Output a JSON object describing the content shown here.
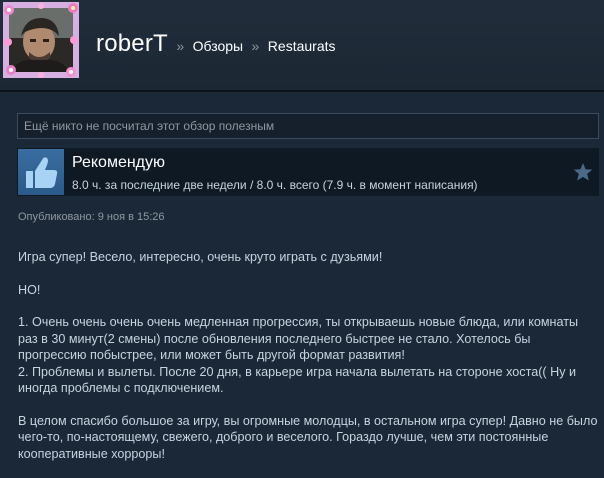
{
  "header": {
    "username": "roberT",
    "separator": "»",
    "breadcrumb_reviews": "Обзоры",
    "breadcrumb_game": "Restaurats"
  },
  "helpful_box": {
    "text": "Ещё никто не посчитал этот обзор полезным"
  },
  "recommendation": {
    "title": "Рекомендую",
    "hours": "8.0 ч. за последние две недели / 8.0 ч. всего (7.9 ч. в момент написания)",
    "icon": "thumbs-up-icon",
    "award_icon": "star-icon"
  },
  "posted": {
    "text": "Опубликовано: 9 ноя в 15:26"
  },
  "review": {
    "p1": "Игра супер! Весело, интересно, очень круто играть с дузьями!",
    "p2": "НО!",
    "p3_line1": "1. Очень очень очень очень медленная прогрессия, ты открываешь новые блюда, или комнаты раз в 30 минут(2 смены) после обновления последнего быстрее не стало. Хотелось бы прогрессию побыстрее, или может быть другой формат развития!",
    "p3_line2": "2. Проблемы и вылеты. После 20 дня, в карьере игра начала вылетать на стороне хоста(( Ну и иногда проблемы с подключением.",
    "p4": "В целом спасибо большое за игру, вы огромные молодцы, в остальном игра супер! Давно не было чего-то, по-настоящему, свежего, доброго и веселого. Гораздо лучше, чем эти постоянные кооперативные хорроры!"
  },
  "colors": {
    "background": "#1b2838",
    "text": "#c6d4df",
    "muted": "#8f98a0",
    "recommend_box": "#0f1923",
    "thumb_blue": "#3a6da0"
  }
}
